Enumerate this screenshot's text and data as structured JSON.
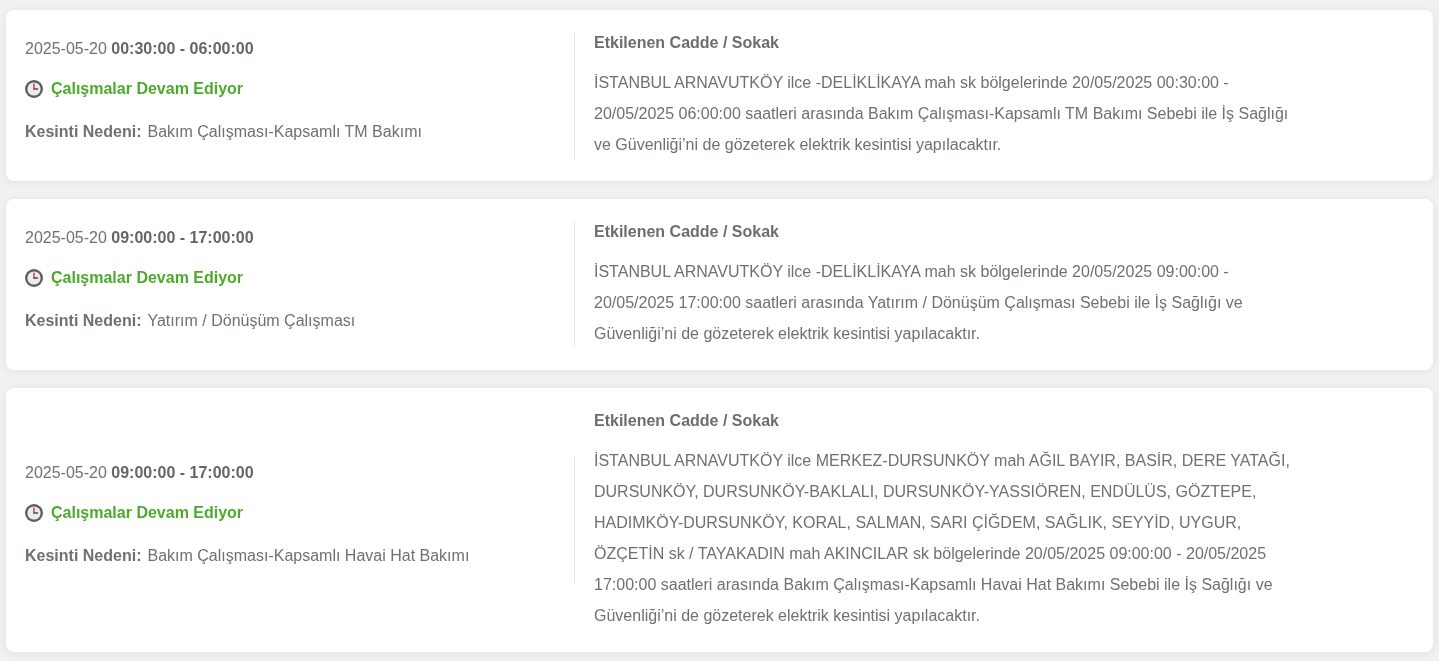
{
  "outages": [
    {
      "date": "2025-05-20",
      "time_range": "00:30:00 - 06:00:00",
      "status": "Çalışmalar Devam Ediyor",
      "reason_label": "Kesinti Nedeni:",
      "reason": "Bakım Çalışması-Kapsamlı TM Bakımı",
      "affected_heading": "Etkilenen Cadde / Sokak",
      "affected_text": "İSTANBUL ARNAVUTKÖY ilce -DELİKLİKAYA mah sk bölgelerinde 20/05/2025 00:30:00 - 20/05/2025 06:00:00 saatleri arasında Bakım Çalışması-Kapsamlı TM Bakımı Sebebi ile İş Sağlığı ve Güvenliği’ni de gözeterek elektrik kesintisi yapılacaktır."
    },
    {
      "date": "2025-05-20",
      "time_range": "09:00:00 - 17:00:00",
      "status": "Çalışmalar Devam Ediyor",
      "reason_label": "Kesinti Nedeni:",
      "reason": "Yatırım / Dönüşüm Çalışması",
      "affected_heading": "Etkilenen Cadde / Sokak",
      "affected_text": "İSTANBUL ARNAVUTKÖY ilce -DELİKLİKAYA mah sk bölgelerinde 20/05/2025 09:00:00 - 20/05/2025 17:00:00 saatleri arasında Yatırım / Dönüşüm Çalışması Sebebi ile İş Sağlığı ve Güvenliği’ni de gözeterek elektrik kesintisi yapılacaktır."
    },
    {
      "date": "2025-05-20",
      "time_range": "09:00:00 - 17:00:00",
      "status": "Çalışmalar Devam Ediyor",
      "reason_label": "Kesinti Nedeni:",
      "reason": "Bakım Çalışması-Kapsamlı Havai Hat Bakımı",
      "affected_heading": "Etkilenen Cadde / Sokak",
      "affected_text": "İSTANBUL ARNAVUTKÖY ilce MERKEZ-DURSUNKÖY mah AĞIL BAYIR, BASİR, DERE YATAĞI, DURSUNKÖY, DURSUNKÖY-BAKLALI, DURSUNKÖY-YASSIÖREN, ENDÜLÜS, GÖZTEPE, HADIMKÖY-DURSUNKÖY, KORAL, SALMAN, SARI ÇİĞDEM, SAĞLIK, SEYYİD, UYGUR, ÖZÇETİN sk / TAYAKADIN mah AKINCILAR sk bölgelerinde 20/05/2025 09:00:00 - 20/05/2025 17:00:00 saatleri arasında Bakım Çalışması-Kapsamlı Havai Hat Bakımı Sebebi ile İş Sağlığı ve Güvenliği’ni de gözeterek elektrik kesintisi yapılacaktır."
    }
  ]
}
